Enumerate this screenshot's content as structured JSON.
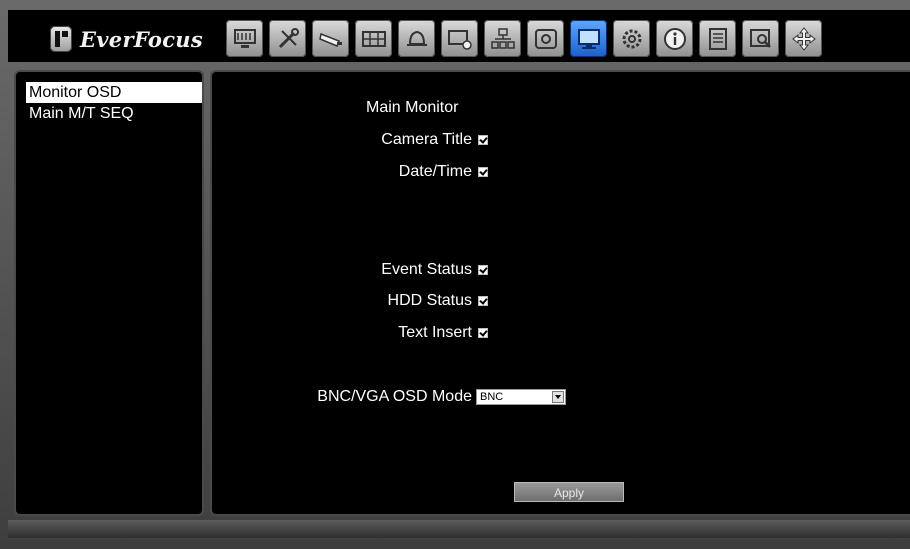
{
  "app": {
    "logo_text": "EverFocus"
  },
  "toolbar": {
    "buttons": [
      {
        "icon": "monitor-icon"
      },
      {
        "icon": "tools-icon"
      },
      {
        "icon": "camera-icon"
      },
      {
        "icon": "film-icon"
      },
      {
        "icon": "alarm-bell-icon"
      },
      {
        "icon": "record-schedule-icon"
      },
      {
        "icon": "network-icon"
      },
      {
        "icon": "storage-disk-icon"
      },
      {
        "icon": "display-settings-icon",
        "active": true
      },
      {
        "icon": "gear-icon"
      },
      {
        "icon": "info-icon"
      },
      {
        "icon": "log-list-icon"
      },
      {
        "icon": "search-icon"
      },
      {
        "icon": "ptz-arrows-icon"
      }
    ]
  },
  "sidebar": {
    "items": [
      {
        "label": "Monitor OSD",
        "selected": true
      },
      {
        "label": "Main M/T SEQ",
        "selected": false
      }
    ]
  },
  "main": {
    "heading": "Main Monitor",
    "options": {
      "camera_title": {
        "label": "Camera Title",
        "checked": true
      },
      "date_time": {
        "label": "Date/Time",
        "checked": true
      },
      "event_status": {
        "label": "Event Status",
        "checked": true
      },
      "hdd_status": {
        "label": "HDD Status",
        "checked": true
      },
      "text_insert": {
        "label": "Text Insert",
        "checked": true
      }
    },
    "osd_mode": {
      "label": "BNC/VGA OSD Mode",
      "value": "BNC"
    },
    "apply_label": "Apply"
  }
}
